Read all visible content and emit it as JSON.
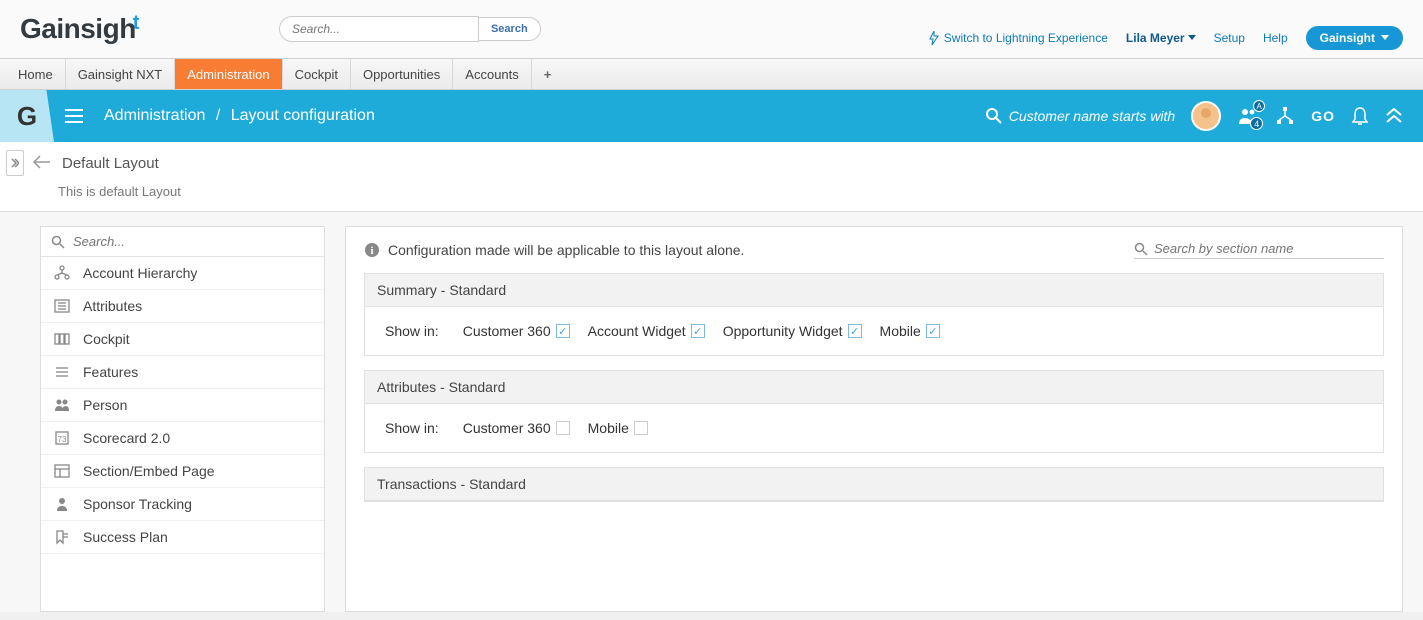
{
  "header": {
    "logo_text": "Gainsigh",
    "search_placeholder": "Search...",
    "search_button": "Search",
    "lightning_link": "Switch to Lightning Experience",
    "user_name": "Lila Meyer",
    "setup": "Setup",
    "help": "Help",
    "app_pill": "Gainsight"
  },
  "tabs": {
    "items": [
      "Home",
      "Gainsight NXT",
      "Administration",
      "Cockpit",
      "Opportunities",
      "Accounts"
    ],
    "active_index": 2
  },
  "gs_bar": {
    "breadcrumb_root": "Administration",
    "breadcrumb_leaf": "Layout configuration",
    "search_hint": "Customer name starts with",
    "badge_count": "4",
    "go_label": "GO"
  },
  "sub": {
    "layout_name": "Default Layout",
    "layout_desc": "This is default Layout"
  },
  "left": {
    "search_placeholder": "Search...",
    "items": [
      {
        "label": "Account Hierarchy",
        "icon": "hierarchy"
      },
      {
        "label": "Attributes",
        "icon": "list"
      },
      {
        "label": "Cockpit",
        "icon": "cockpit"
      },
      {
        "label": "Features",
        "icon": "features"
      },
      {
        "label": "Person",
        "icon": "person"
      },
      {
        "label": "Scorecard 2.0",
        "icon": "scorecard"
      },
      {
        "label": "Section/Embed Page",
        "icon": "embed"
      },
      {
        "label": "Sponsor Tracking",
        "icon": "sponsor"
      },
      {
        "label": "Success Plan",
        "icon": "plan"
      }
    ]
  },
  "right": {
    "info_text": "Configuration made will be applicable to this layout alone.",
    "section_search_placeholder": "Search by section name",
    "show_in_label": "Show in:",
    "sections": [
      {
        "title": "Summary - Standard",
        "options": [
          {
            "label": "Customer 360",
            "checked": true
          },
          {
            "label": "Account Widget",
            "checked": true
          },
          {
            "label": "Opportunity Widget",
            "checked": true
          },
          {
            "label": "Mobile",
            "checked": true
          }
        ]
      },
      {
        "title": "Attributes - Standard",
        "options": [
          {
            "label": "Customer 360",
            "checked": false
          },
          {
            "label": "Mobile",
            "checked": false
          }
        ]
      },
      {
        "title": "Transactions - Standard",
        "options": []
      }
    ]
  }
}
